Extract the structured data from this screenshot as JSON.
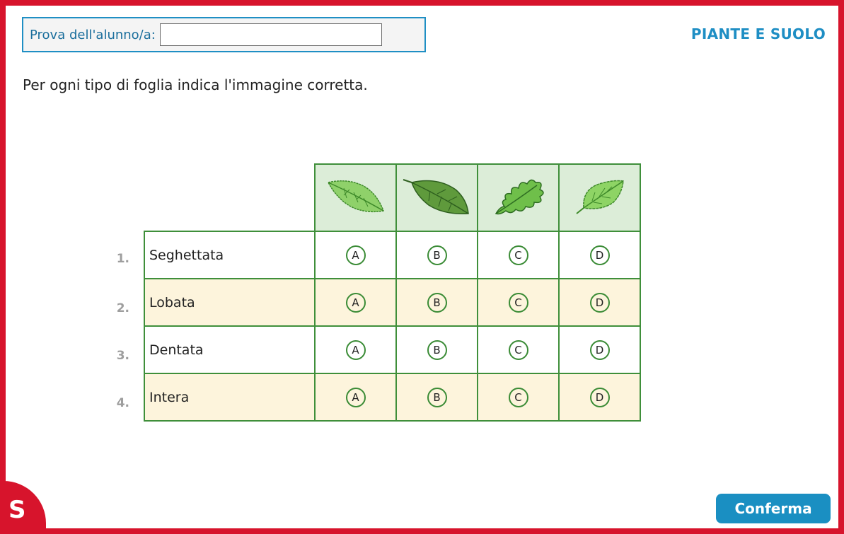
{
  "header": {
    "student_label": "Prova dell'alunno/a:",
    "student_value": "",
    "topic": "PIANTE E SUOLO"
  },
  "instruction": "Per ogni tipo di foglia indica l'immagine corretta.",
  "table": {
    "columns": [
      {
        "key": "A",
        "leaf_icon": "serrated-leaf-icon"
      },
      {
        "key": "B",
        "leaf_icon": "smooth-dark-leaf-icon"
      },
      {
        "key": "C",
        "leaf_icon": "lobed-oak-leaf-icon"
      },
      {
        "key": "D",
        "leaf_icon": "toothed-leaf-icon"
      }
    ],
    "rows": [
      {
        "number": "1.",
        "label": "Seghettata",
        "options": [
          "A",
          "B",
          "C",
          "D"
        ]
      },
      {
        "number": "2.",
        "label": "Lobata",
        "options": [
          "A",
          "B",
          "C",
          "D"
        ]
      },
      {
        "number": "3.",
        "label": "Dentata",
        "options": [
          "A",
          "B",
          "C",
          "D"
        ]
      },
      {
        "number": "4.",
        "label": "Intera",
        "options": [
          "A",
          "B",
          "C",
          "D"
        ]
      }
    ]
  },
  "footer": {
    "logo_letter": "S",
    "confirm_label": "Conferma"
  },
  "colors": {
    "frame": "#d7142c",
    "accent": "#1e8ec4",
    "grid": "#3f8f3a",
    "row_alt": "#fdf4dc",
    "leaf_header": "#dcedd8"
  }
}
